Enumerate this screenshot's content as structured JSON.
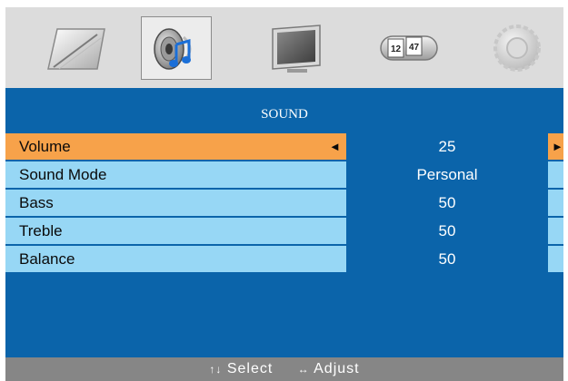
{
  "menu": {
    "tabs": [
      {
        "icon": "picture-icon",
        "selected": false
      },
      {
        "icon": "sound-icon",
        "selected": true
      },
      {
        "icon": "screen-icon",
        "selected": false
      },
      {
        "icon": "clock-icon",
        "selected": false
      },
      {
        "icon": "settings-gear-icon",
        "selected": false
      }
    ],
    "title": "SOUND",
    "rows": [
      {
        "label": "Volume",
        "value": "25",
        "active": true
      },
      {
        "label": "Sound Mode",
        "value": "Personal",
        "active": false
      },
      {
        "label": "Bass",
        "value": "50",
        "active": false
      },
      {
        "label": "Treble",
        "value": "50",
        "active": false
      },
      {
        "label": "Balance",
        "value": "50",
        "active": false
      }
    ],
    "arrows": {
      "left": "◄",
      "right": "►"
    },
    "clock_digits": [
      "12",
      "47"
    ],
    "footer": {
      "select_arrows": "↑↓",
      "select_label": "Select",
      "adjust_arrows": "↔",
      "adjust_label": "Adjust"
    }
  },
  "colors": {
    "panel_blue": "#0b64aa",
    "row_light_blue": "#97d7f5",
    "highlight_orange": "#f7a24a",
    "footer_gray": "#868686",
    "iconbar_gray": "#dcdcdc"
  }
}
